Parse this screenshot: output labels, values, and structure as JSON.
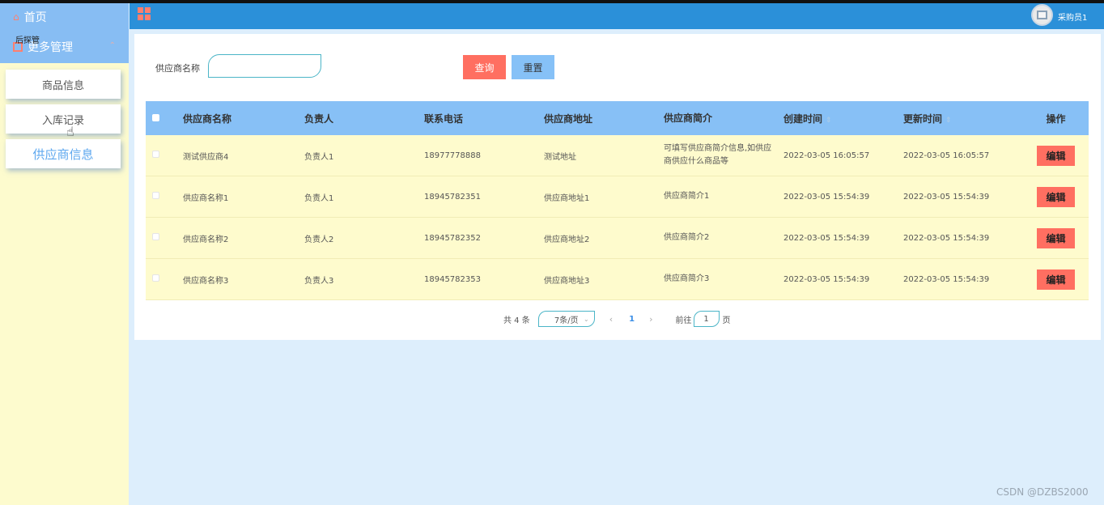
{
  "sidebar": {
    "home_label": "首页",
    "group_label": "更多管理",
    "group_tooltip": "后探管",
    "items": [
      {
        "label": "商品信息"
      },
      {
        "label": "入库记录"
      },
      {
        "label": "供应商信息"
      }
    ]
  },
  "header": {
    "user_name": "采购员1"
  },
  "search": {
    "label": "供应商名称",
    "value": "",
    "query_label": "查询",
    "reset_label": "重置"
  },
  "table": {
    "columns": [
      "供应商名称",
      "负责人",
      "联系电话",
      "供应商地址",
      "供应商简介",
      "创建时间",
      "更新时间",
      "操作"
    ],
    "rows": [
      {
        "name": "测试供应商4",
        "owner": "负责人1",
        "phone": "18977778888",
        "address": "测试地址",
        "intro": "可填写供应商简介信息,如供应商供应什么商品等",
        "created": "2022-03-05 16:05:57",
        "updated": "2022-03-05 16:05:57",
        "action": "编辑"
      },
      {
        "name": "供应商名称1",
        "owner": "负责人1",
        "phone": "18945782351",
        "address": "供应商地址1",
        "intro": "供应商简介1",
        "created": "2022-03-05 15:54:39",
        "updated": "2022-03-05 15:54:39",
        "action": "编辑"
      },
      {
        "name": "供应商名称2",
        "owner": "负责人2",
        "phone": "18945782352",
        "address": "供应商地址2",
        "intro": "供应商简介2",
        "created": "2022-03-05 15:54:39",
        "updated": "2022-03-05 15:54:39",
        "action": "编辑"
      },
      {
        "name": "供应商名称3",
        "owner": "负责人3",
        "phone": "18945782353",
        "address": "供应商地址3",
        "intro": "供应商简介3",
        "created": "2022-03-05 15:54:39",
        "updated": "2022-03-05 15:54:39",
        "action": "编辑"
      }
    ]
  },
  "pagination": {
    "total": "共 4 条",
    "page_size": "7条/页",
    "current_page": "1",
    "goto_prefix": "前往",
    "goto_value": "1",
    "goto_suffix": "页"
  },
  "watermark": "CSDN @DZBS2000",
  "colors": {
    "header": "#2b90d9",
    "sidebar": "#fdfbce",
    "table_header": "#87c0f6",
    "row": "#fefbcd",
    "danger": "#ff6f61"
  }
}
